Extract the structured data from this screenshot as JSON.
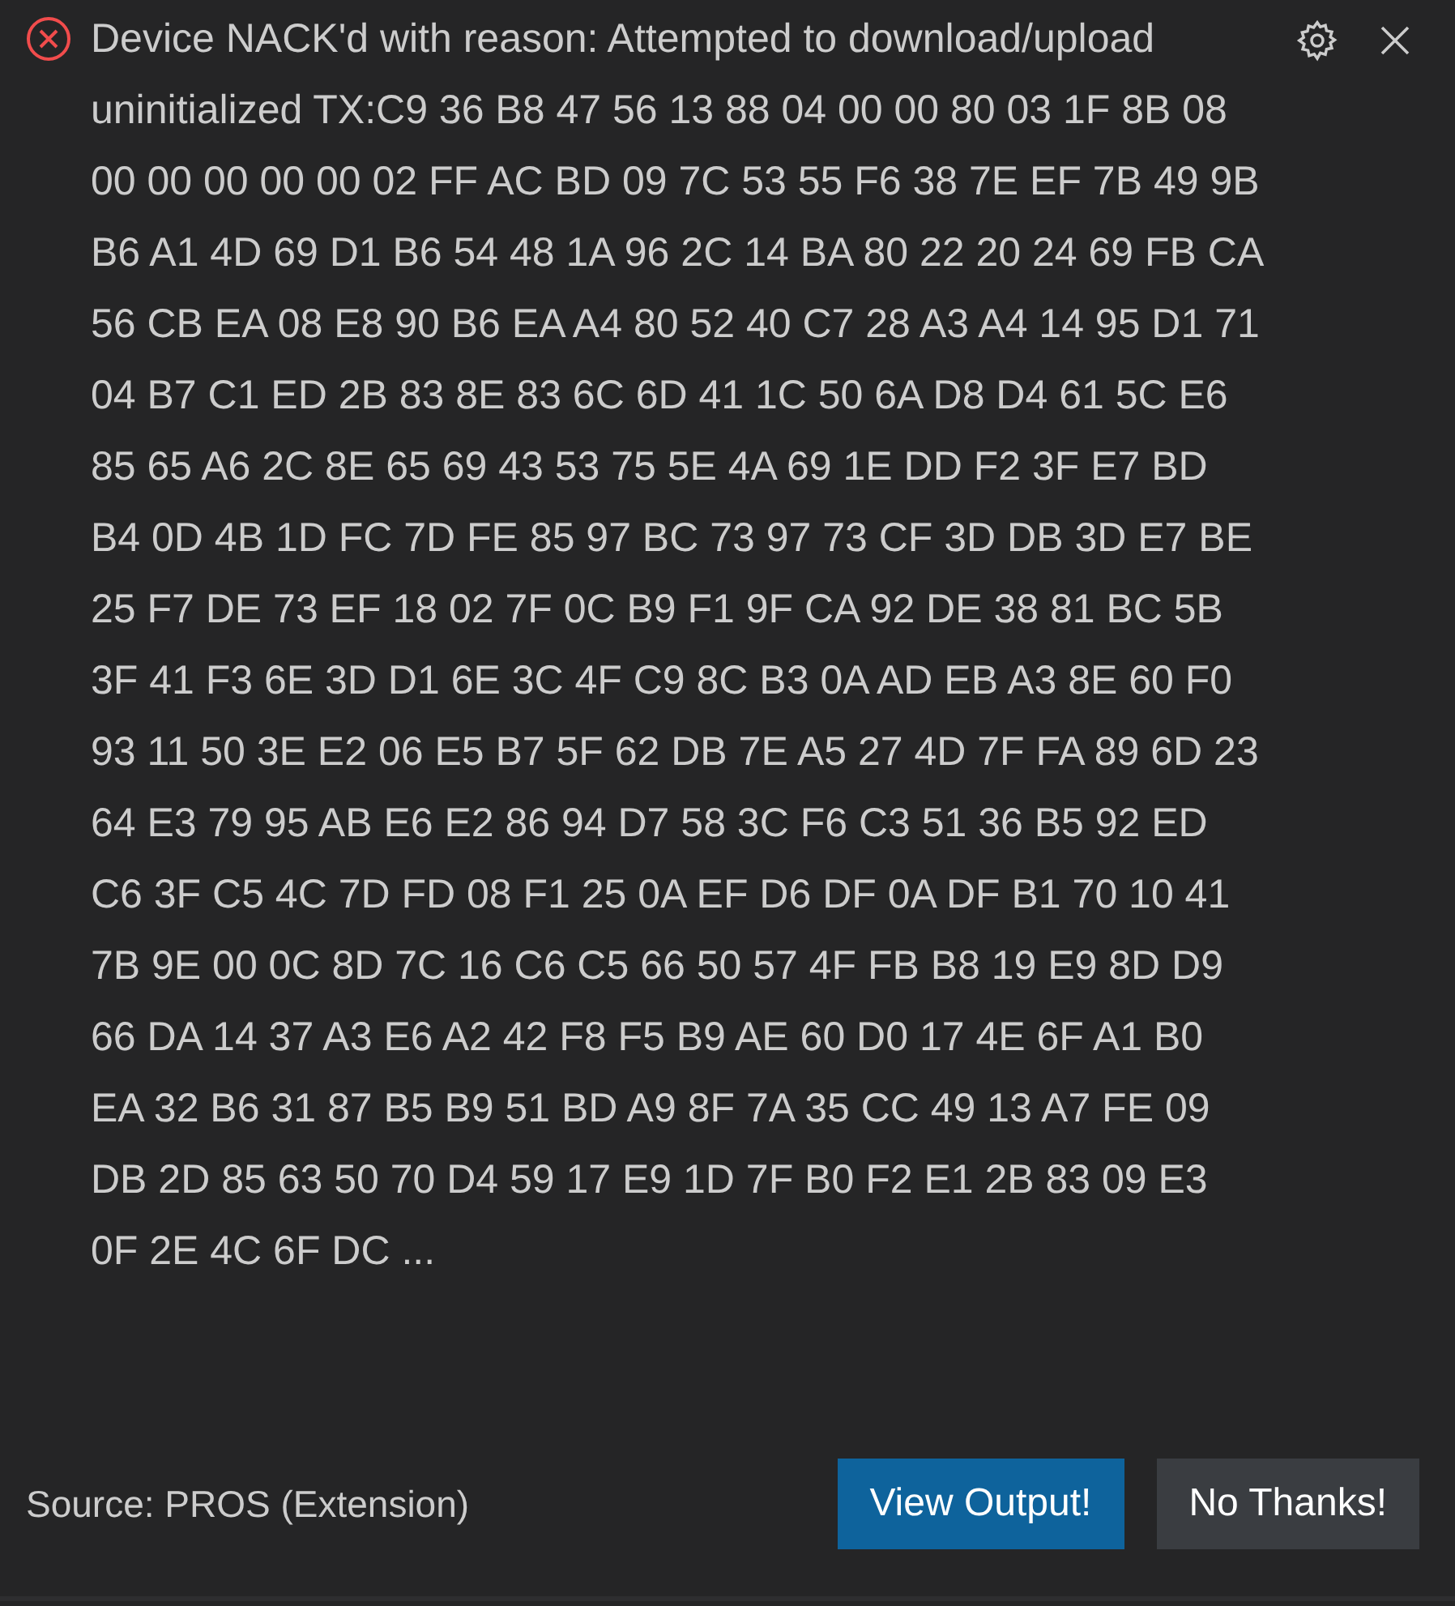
{
  "notification": {
    "kind": "error",
    "message": "Device NACK'd with reason: Attempted to download/upload uninitialized TX:C9 36 B8 47 56 13 88 04 00 00 80 03 1F 8B 08 00 00 00 00 00 02 FF AC BD 09 7C 53 55 F6 38 7E EF 7B 49 9B B6 A1 4D 69 D1 B6 54 48 1A 96 2C 14 BA 80 22 20 24 69 FB CA 56 CB EA 08 E8 90 B6 EA A4 80 52 40 C7 28 A3 A4 14 95 D1 71 04 B7 C1 ED 2B 83 8E 83 6C 6D 41 1C 50 6A D8 D4 61 5C E6 85 65 A6 2C 8E 65 69 43 53 75 5E 4A 69 1E DD F2 3F E7 BD B4 0D 4B 1D FC 7D FE 85 97 BC 73 97 73 CF 3D DB 3D E7 BE 25 F7 DE 73 EF 18 02 7F 0C B9 F1 9F CA 92 DE 38 81 BC 5B 3F 41 F3 6E 3D D1 6E 3C 4F C9 8C B3 0A AD EB A3 8E 60 F0 93 11 50 3E E2 06 E5 B7 5F 62 DB 7E A5 27 4D 7F FA 89 6D 23 64 E3 79 95 AB E6 E2 86 94 D7 58 3C F6 C3 51 36 B5 92 ED C6 3F C5 4C 7D FD 08 F1 25 0A EF D6 DF 0A DF B1 70 10 41 7B 9E 00 0C 8D 7C 16 C6 C5 66 50 57 4F FB B8 19 E9 8D D9 66 DA 14 37 A3 E6 A2 42 F8 F5 B9 AE 60 D0 17 4E 6F A1 B0 EA 32 B6 31 87 B5 B9 51 BD A9 8F 7A 35 CC 49 13 A7 FE 09 DB 2D 85 63 50 70 D4 59 17 E9 1D 7F B0 F2 E1 2B 83 09 E3 0F 2E 4C 6F DC ...",
    "source": "Source: PROS (Extension)",
    "buttons": [
      {
        "label": "View Output!",
        "kind": "primary"
      },
      {
        "label": "No Thanks!",
        "kind": "secondary"
      }
    ]
  }
}
